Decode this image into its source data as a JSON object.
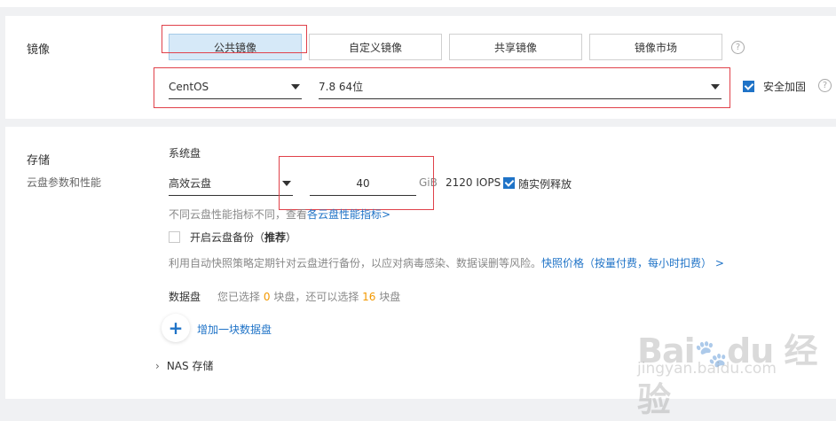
{
  "image_section": {
    "label": "镜像",
    "tabs": [
      {
        "label": "公共镜像",
        "active": true
      },
      {
        "label": "自定义镜像",
        "active": false
      },
      {
        "label": "共享镜像",
        "active": false
      },
      {
        "label": "镜像市场",
        "active": false
      }
    ],
    "os_select": "CentOS",
    "version_select": "7.8 64位",
    "security_hardening": {
      "label": "安全加固",
      "checked": true
    }
  },
  "storage_section": {
    "label": "存储",
    "sub_label": "云盘参数和性能",
    "system_disk": {
      "label": "系统盘",
      "type": "高效云盘",
      "size": "40",
      "unit": "GiB",
      "iops": "2120 IOPS",
      "release_with_instance": {
        "label": "随实例释放",
        "checked": true
      },
      "perf_note": "不同云盘性能指标不同，查看",
      "perf_link": "各云盘性能指标",
      "perf_link_arrow": ">"
    },
    "backup": {
      "label": "开启云盘备份（",
      "recommend": "推荐",
      "label_end": "）",
      "checked": false,
      "note": "利用自动快照策略定期针对云盘进行备份，以应对病毒感染、数据误删等风险。",
      "price_link": "快照价格（按量付费，每小时扣费）",
      "price_link_arrow": ">"
    },
    "data_disk": {
      "label": "数据盘",
      "text_selected_prefix": "您已选择",
      "selected_count": "0",
      "text_mid": "块盘，还可以选择",
      "remaining_count": "16",
      "text_suffix": "块盘",
      "add_label": "增加一块数据盘"
    },
    "nas": {
      "label": "NAS 存储"
    }
  },
  "watermark": {
    "logo": "Bai du 经验",
    "url": "jingyan.baidu.com"
  },
  "colors": {
    "link": "#1f73c7",
    "orange": "#f39800",
    "highlight_box": "#e0414a"
  }
}
